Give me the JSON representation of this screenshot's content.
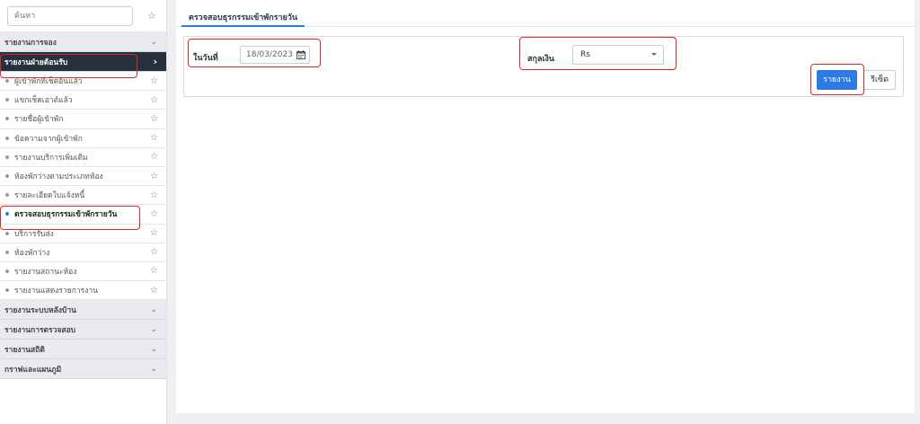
{
  "search": {
    "placeholder": "ค้นหา"
  },
  "sidebar": {
    "groups_top": [
      {
        "label": "รายงานการจอง"
      }
    ],
    "active_group": {
      "label": "รายงานฝ่ายต้อนรับ",
      "chevron": "chevron-right-icon"
    },
    "items": [
      {
        "label": "ผู้เข้าพักที่เช็คอินแล้ว"
      },
      {
        "label": "แขกเช็คเอาต์แล้ว"
      },
      {
        "label": "รายชื่อผู้เข้าพัก"
      },
      {
        "label": "ข้อความจากผู้เข้าพัก"
      },
      {
        "label": "รายงานบริการเพิ่มเติม"
      },
      {
        "label": "ห้องพักว่างตามประเภทห้อง"
      },
      {
        "label": "รายละเอียดใบแจ้งหนี้"
      },
      {
        "label": "ตรวจสอบธุรกรรมเข้าพักรายวัน"
      },
      {
        "label": "บริการรับส่ง"
      },
      {
        "label": "ห้องพักว่าง"
      },
      {
        "label": "รายงานสถานะห้อง"
      },
      {
        "label": "รายงานแสดงรายการงาน"
      }
    ],
    "groups_bottom": [
      {
        "label": "รายงานระบบหลังบ้าน"
      },
      {
        "label": "รายงานการตรวจสอบ"
      },
      {
        "label": "รายงานสถิติ"
      },
      {
        "label": "กราฟและแผนภูมิ"
      }
    ]
  },
  "main": {
    "tab_label": "ตรวจสอบธุรกรรมเข้าพักรายวัน",
    "date_label": "ในวันที่",
    "date_value": "18/03/2023",
    "currency_label": "สกุลเงิน",
    "currency_value": "Rs",
    "report_button": "รายงาน",
    "reset_button": "รีเซ็ต"
  },
  "colors": {
    "accent": "#2e7be5",
    "sidebar_active": "#27313d",
    "highlight": "#e0252b"
  }
}
